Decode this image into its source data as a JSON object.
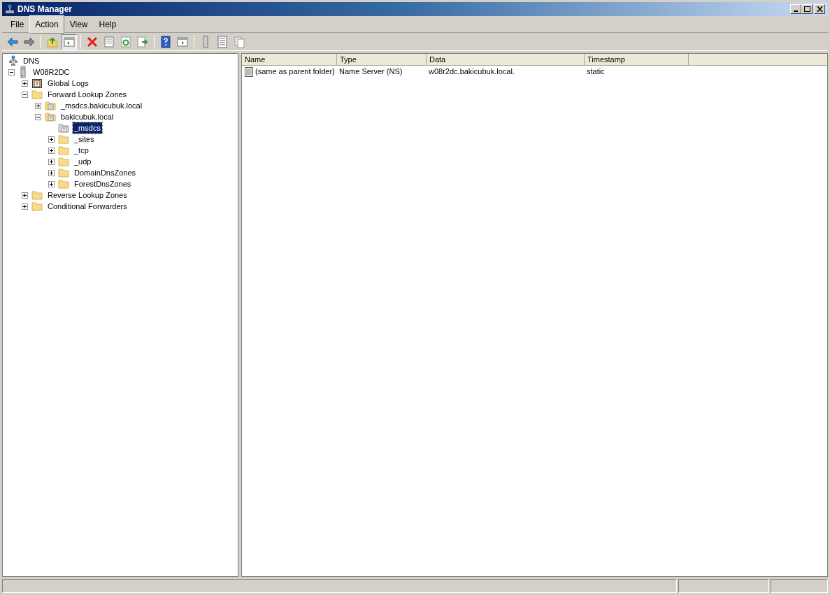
{
  "window": {
    "title": "DNS Manager"
  },
  "menu": [
    {
      "label": "File",
      "selected": false
    },
    {
      "label": "Action",
      "selected": true
    },
    {
      "label": "View",
      "selected": false
    },
    {
      "label": "Help",
      "selected": false
    }
  ],
  "toolbar": [
    {
      "kind": "back",
      "pressed": false
    },
    {
      "kind": "forward",
      "pressed": false
    },
    {
      "kind": "sep"
    },
    {
      "kind": "up",
      "pressed": false
    },
    {
      "kind": "tree",
      "pressed": true
    },
    {
      "kind": "sep"
    },
    {
      "kind": "delete",
      "pressed": false
    },
    {
      "kind": "properties",
      "pressed": false
    },
    {
      "kind": "refresh",
      "pressed": false
    },
    {
      "kind": "export",
      "pressed": false
    },
    {
      "kind": "sep"
    },
    {
      "kind": "help",
      "pressed": false
    },
    {
      "kind": "pane",
      "pressed": false
    },
    {
      "kind": "sep"
    },
    {
      "kind": "server",
      "pressed": false
    },
    {
      "kind": "list",
      "pressed": false
    },
    {
      "kind": "copy",
      "pressed": false
    }
  ],
  "tree": [
    {
      "label": "DNS",
      "kind": "root",
      "selected": false,
      "children": [
        {
          "label": "W08R2DC",
          "kind": "server",
          "selected": false,
          "expanded": true,
          "children": [
            {
              "label": "Global Logs",
              "kind": "logs",
              "selected": false,
              "expanded": false
            },
            {
              "label": "Forward Lookup Zones",
              "kind": "folder",
              "selected": false,
              "expanded": true,
              "children": [
                {
                  "label": "_msdcs.bakicubuk.local",
                  "kind": "zone",
                  "selected": false,
                  "expanded": false
                },
                {
                  "label": "bakicubuk.local",
                  "kind": "zone",
                  "selected": false,
                  "expanded": true,
                  "children": [
                    {
                      "label": "_msdcs",
                      "kind": "delegation",
                      "selected": true
                    },
                    {
                      "label": "_sites",
                      "kind": "folder",
                      "selected": false,
                      "expanded": false
                    },
                    {
                      "label": "_tcp",
                      "kind": "folder",
                      "selected": false,
                      "expanded": false
                    },
                    {
                      "label": "_udp",
                      "kind": "folder",
                      "selected": false,
                      "expanded": false
                    },
                    {
                      "label": "DomainDnsZones",
                      "kind": "folder",
                      "selected": false,
                      "expanded": false
                    },
                    {
                      "label": "ForestDnsZones",
                      "kind": "folder",
                      "selected": false,
                      "expanded": false
                    }
                  ]
                }
              ]
            },
            {
              "label": "Reverse Lookup Zones",
              "kind": "folder",
              "selected": false,
              "expanded": false
            },
            {
              "label": "Conditional Forwarders",
              "kind": "folder",
              "selected": false,
              "expanded": false
            }
          ]
        }
      ]
    }
  ],
  "table": {
    "columns": [
      "Name",
      "Type",
      "Data",
      "Timestamp"
    ],
    "rows": [
      {
        "cells": [
          "(same as parent folder)",
          "Name Server (NS)",
          "w08r2dc.bakicubuk.local.",
          "static"
        ]
      }
    ]
  }
}
